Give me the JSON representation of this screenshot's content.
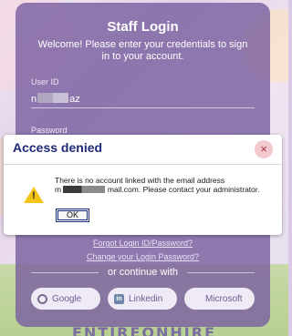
{
  "login_card": {
    "title": "Staff Login",
    "subtitle": "Welcome! Please enter your credentials to sign in to your account.",
    "user_id_label": "User ID",
    "user_id_value_start": "n",
    "user_id_value_end": "az",
    "password_label": "Password",
    "forgot_link": "Forgot Login ID/Password?",
    "change_link": "Change your Login Password?",
    "continue_with": "or continue with",
    "sso": [
      {
        "label": "Google",
        "icon": "google-icon"
      },
      {
        "label": "Linkedin",
        "icon": "linkedin-icon"
      },
      {
        "label": "Microsoft",
        "icon": "microsoft-icon"
      }
    ]
  },
  "dialog": {
    "title": "Access denied",
    "close_icon": "×",
    "warning_icon": "warning-icon",
    "warning_mark": "!",
    "message_part1": "There is no account linked with the email address",
    "message_prefix": "m",
    "message_part2": "mail.com. Please contact your administrator.",
    "ok_label": "OK"
  },
  "brand_text": "ENTIREONHIRE",
  "colors": {
    "card": "#7a60a0",
    "dialog_title": "#1d2a7a",
    "close_bg": "#f2c9cf",
    "warning": "#f2c318"
  }
}
